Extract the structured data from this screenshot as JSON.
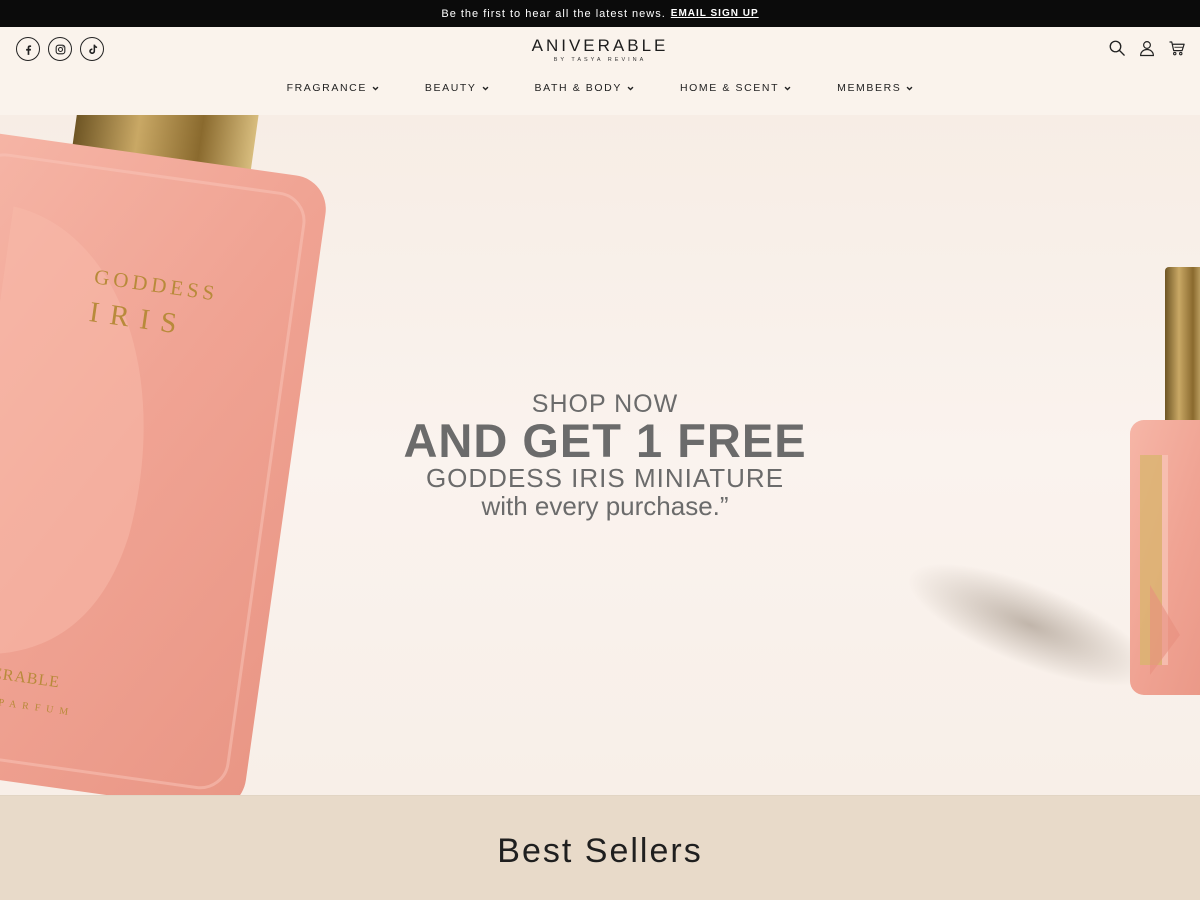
{
  "announcement": {
    "text": "Be the first to hear all the latest news.",
    "link": "EMAIL SIGN UP"
  },
  "header": {
    "socials": [
      "facebook-icon",
      "instagram-icon",
      "tiktok-icon"
    ],
    "logo": {
      "brand": "ANIVERABLE",
      "sub": "BY TASYA REVINA"
    },
    "utilities": [
      "search-icon",
      "account-icon",
      "cart-icon"
    ]
  },
  "nav": [
    {
      "label": "FRAGRANCE"
    },
    {
      "label": "BEAUTY"
    },
    {
      "label": "BATH & BODY"
    },
    {
      "label": "HOME & SCENT"
    },
    {
      "label": "MEMBERS"
    }
  ],
  "hero": {
    "line1": "SHOP NOW",
    "line2": "AND GET 1 FREE",
    "line3": "GODDESS IRIS MINIATURE",
    "line4": "with every purchase.”",
    "bottle_text": {
      "top1": "GODDESS",
      "top2": "IRIS",
      "brand": "ANIVERABLE",
      "type": "T DE PARFUM"
    }
  },
  "best_sellers": {
    "title": "Best Sellers"
  },
  "colors": {
    "announce_bg": "#0b0b0b",
    "page_bg": "#faf3ec",
    "bottle_pink": "#f0a596",
    "cap_gold": "#b08a3c",
    "hero_text": "#6b6b6b",
    "section_bg": "#e8dac9"
  }
}
